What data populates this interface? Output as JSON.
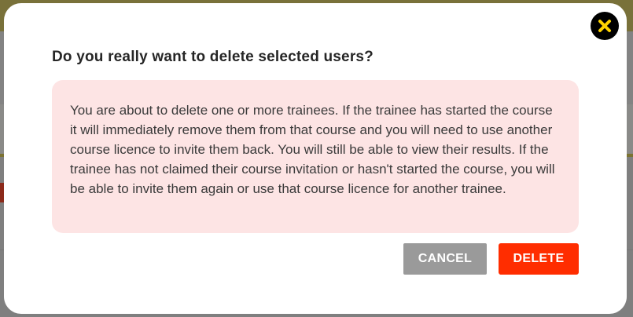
{
  "dialog": {
    "title": "Do you really want to delete selected users?",
    "message": "You are about to delete one or more trainees. If the trainee has started the course it will immediately remove them from that course and you will need to use another course licence to invite them back. You will still be able to view their results. If the trainee has not claimed their course invitation or hasn't started the course, you will be able to invite them again or use that course licence for another trainee.",
    "cancel_label": "CANCEL",
    "delete_label": "DELETE",
    "close_icon": "close-icon"
  },
  "colors": {
    "warning_background": "#fde4e4",
    "delete_button": "#ff2d00",
    "cancel_button": "#9a9a9a",
    "close_icon_accent": "#ffd400"
  }
}
